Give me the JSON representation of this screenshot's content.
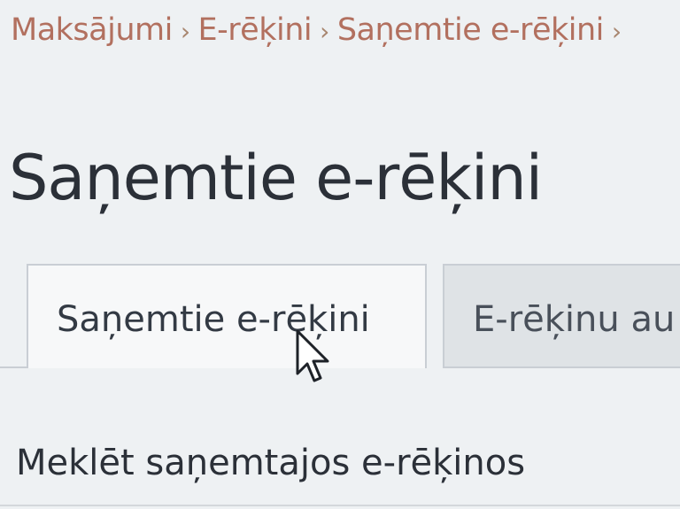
{
  "breadcrumb": {
    "items": [
      "Maksājumi",
      "E-rēķini",
      "Saņemtie e-rēķini"
    ],
    "separator": "›"
  },
  "page": {
    "title": "Saņemtie e-rēķini"
  },
  "tabs": [
    {
      "label": "Saņemtie e-rēķini",
      "active": true
    },
    {
      "label": "E-rēķinu au",
      "active": false
    }
  ],
  "search": {
    "title": "Meklēt saņemtajos e-rēķinos"
  }
}
